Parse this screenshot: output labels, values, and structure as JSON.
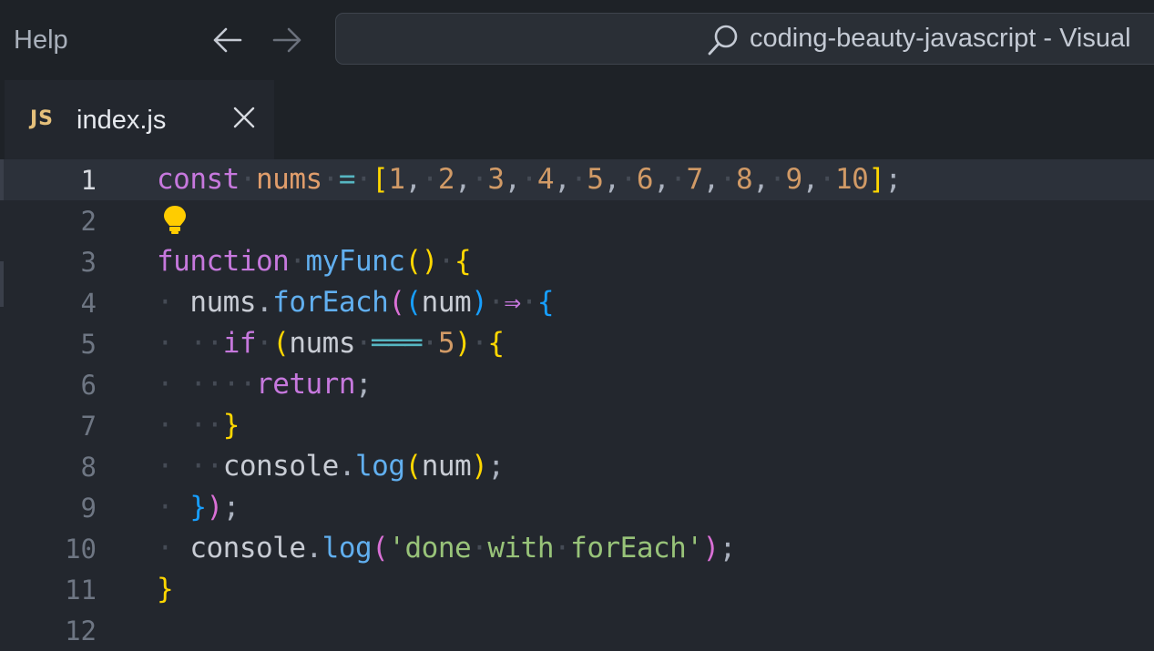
{
  "titlebar": {
    "menu_help": "Help",
    "back_icon": "arrow-left-icon",
    "forward_icon": "arrow-right-icon",
    "command_center": {
      "search_icon": "search-icon",
      "text": "coding-beauty-javascript - Visual"
    }
  },
  "tabs": [
    {
      "icon": "js-icon",
      "icon_text": "JS",
      "label": "index.js",
      "close_icon": "close-icon",
      "active": true
    }
  ],
  "editor": {
    "active_line": 1,
    "lightbulb_icon": "lightbulb-icon",
    "line_numbers": [
      "1",
      "2",
      "3",
      "4",
      "5",
      "6",
      "7",
      "8",
      "9",
      "10",
      "11",
      "12"
    ]
  },
  "colors": {
    "editor_bg": "#23272e",
    "titlebar_bg": "#1e2227",
    "keyword": "#c678dd",
    "function": "#61afef",
    "string": "#98c379",
    "number": "#d19a66",
    "bracket_gold": "#ffd700",
    "bracket_orchid": "#da70d6",
    "bracket_blue": "#179fff"
  }
}
